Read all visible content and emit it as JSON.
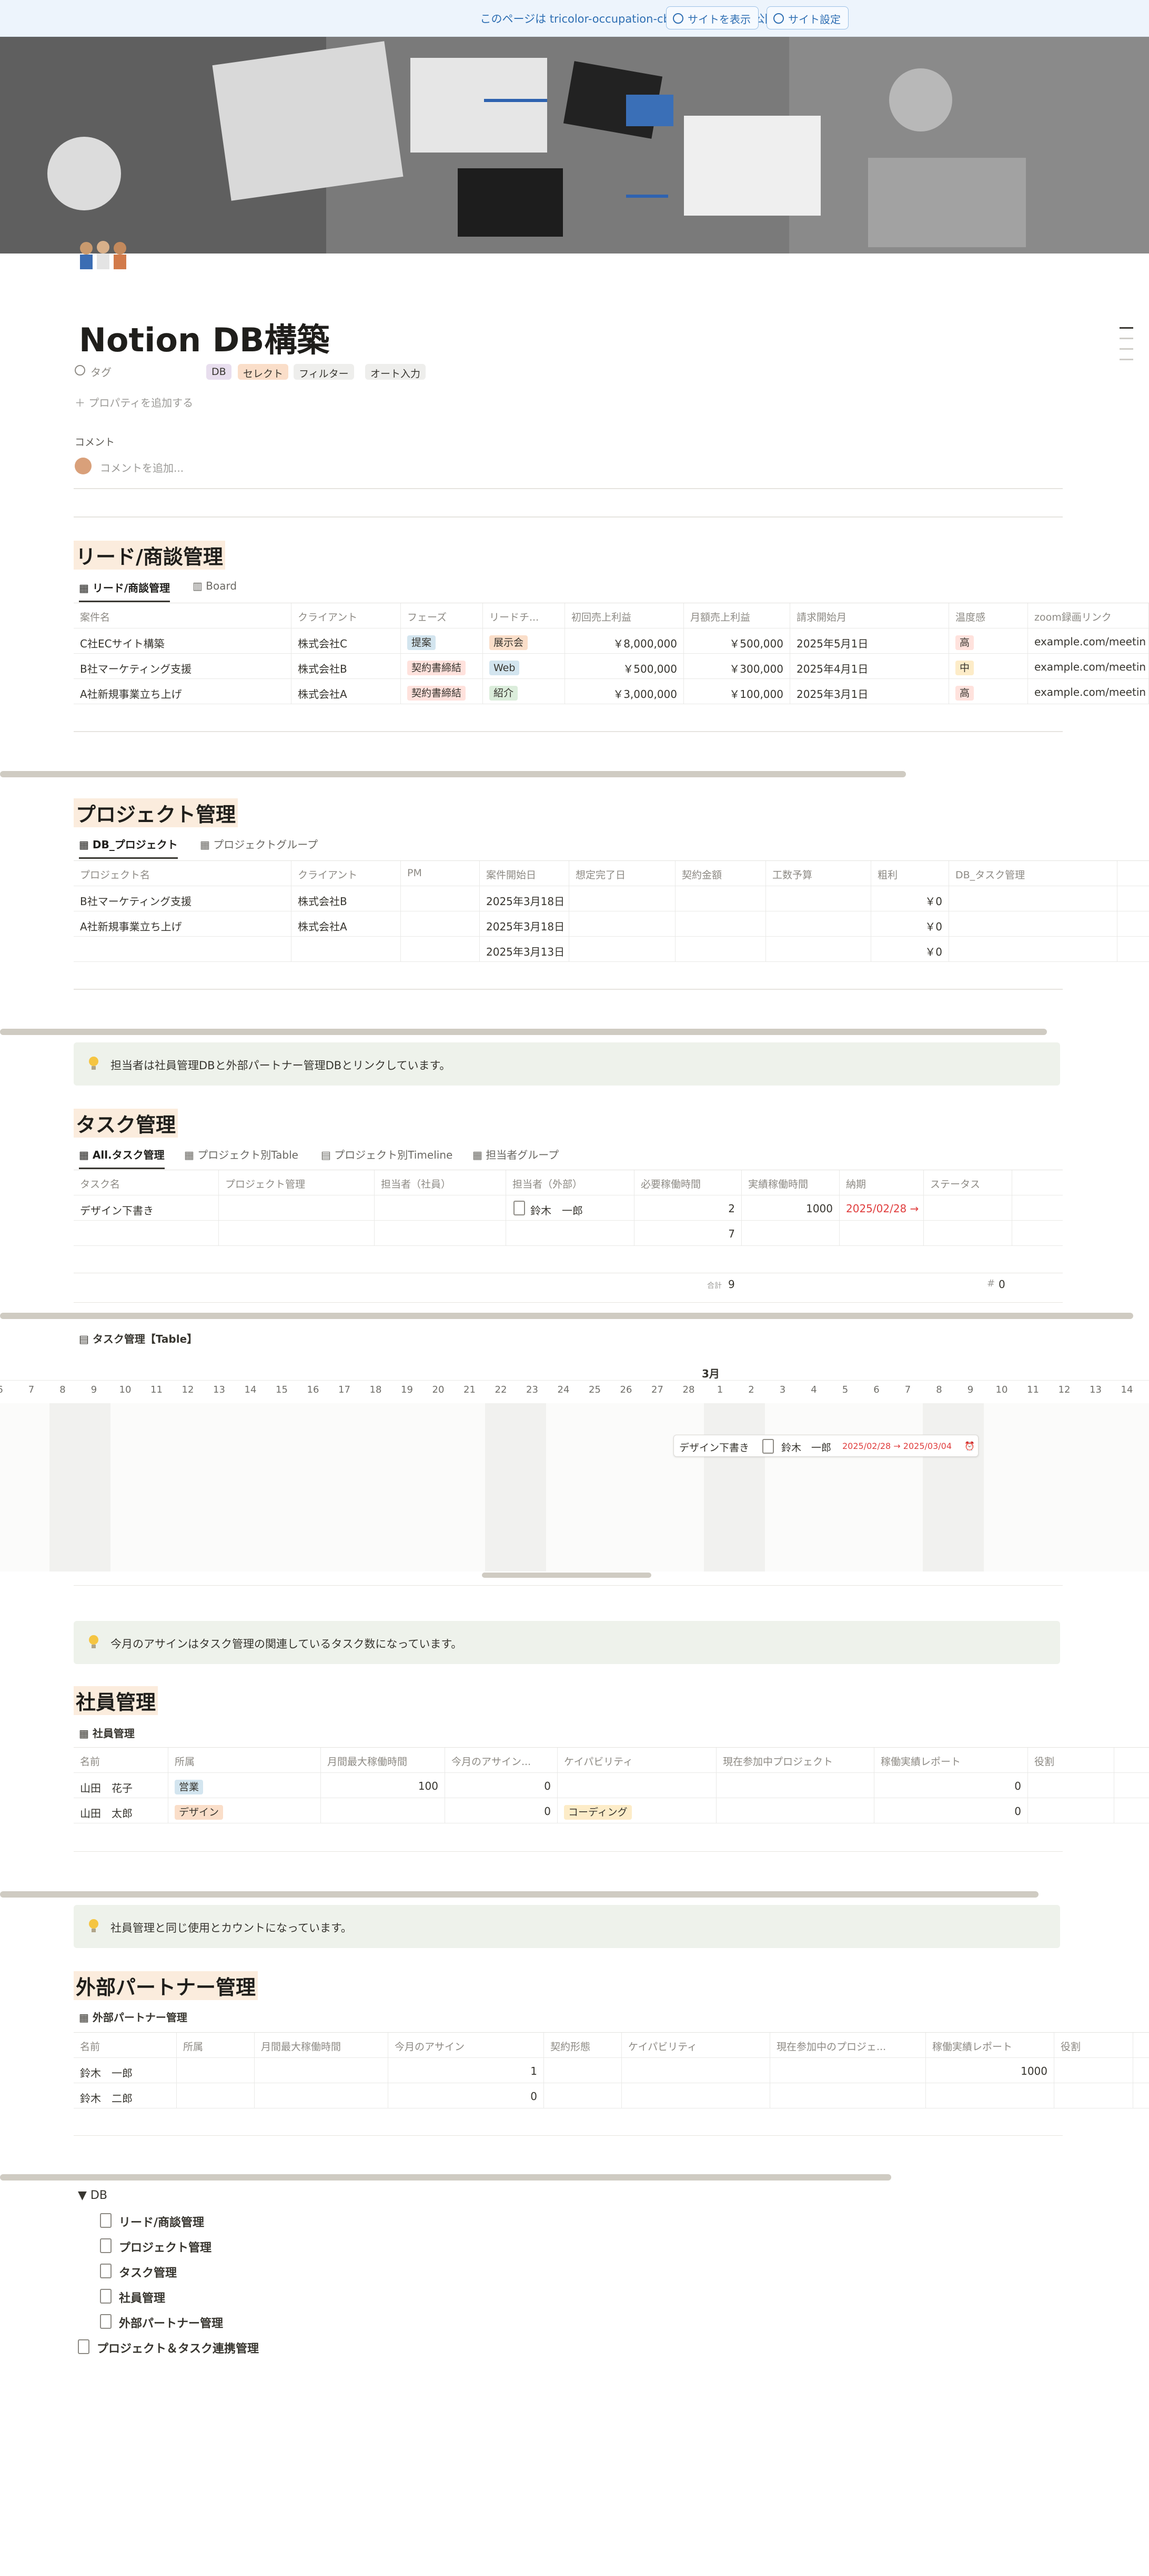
{
  "topbar": {
    "message": "このページは tricolor-occupation-cb8.notion.site で公開されています",
    "view_site": "サイトを表示",
    "site_settings": "サイト設定"
  },
  "page": {
    "title": "Notion DB構築",
    "tag_label": "タグ",
    "tags": [
      {
        "label": "DB",
        "color": "#e8deee"
      },
      {
        "label": "セレクト",
        "color": "#fadec9"
      },
      {
        "label": "フィルター",
        "color": "#eeeeec"
      },
      {
        "label": "オート入力",
        "color": "#eeeeec"
      }
    ],
    "add_property": "プロパティを追加する",
    "comment_label": "コメント",
    "comment_placeholder": "コメントを追加..."
  },
  "lead": {
    "heading": "リード/商談管理",
    "tabs": [
      "リード/商談管理",
      "Board"
    ],
    "columns": [
      "案件名",
      "クライアント",
      "フェーズ",
      "リードチ...",
      "初回売上利益",
      "月額売上利益",
      "請求開始月",
      "温度感",
      "zoom録画リンク"
    ],
    "rows": [
      [
        "C社ECサイト構築",
        "株式会社C",
        "提案",
        "展示会",
        "￥8,000,000",
        "￥500,000",
        "2025年5月1日",
        "高",
        "example.com/meetin"
      ],
      [
        "B社マーケティング支援",
        "株式会社B",
        "契約書締結",
        "Web",
        "￥500,000",
        "￥300,000",
        "2025年4月1日",
        "中",
        "example.com/meetin"
      ],
      [
        "A社新規事業立ち上げ",
        "株式会社A",
        "契約書締結",
        "紹介",
        "￥3,000,000",
        "￥100,000",
        "2025年3月1日",
        "高",
        "example.com/meetin"
      ]
    ]
  },
  "project": {
    "heading": "プロジェクト管理",
    "tabs": [
      "DB_プロジェクト",
      "プロジェクトグループ"
    ],
    "columns": [
      "プロジェクト名",
      "クライアント",
      "PM",
      "案件開始日",
      "想定完了日",
      "契約金額",
      "工数予算",
      "粗利",
      "DB_タスク管理"
    ],
    "rows": [
      [
        "B社マーケティング支援",
        "株式会社B",
        "",
        "2025年3月18日",
        "",
        "",
        "",
        "￥0",
        ""
      ],
      [
        "A社新規事業立ち上げ",
        "株式会社A",
        "",
        "2025年3月18日",
        "",
        "",
        "",
        "￥0",
        ""
      ],
      [
        "",
        "",
        "",
        "2025年3月13日",
        "",
        "",
        "",
        "￥0",
        ""
      ]
    ]
  },
  "task": {
    "callout": "担当者は社員管理DBと外部パートナー管理DBとリンクしています。",
    "heading": "タスク管理",
    "tabs": [
      "All.タスク管理",
      "プロジェクト別Table",
      "プロジェクト別Timeline",
      "担当者グループ"
    ],
    "columns": [
      "タスク名",
      "プロジェクト管理",
      "担当者（社員）",
      "担当者（外部）",
      "必要稼働時間",
      "実績稼働時間",
      "納期",
      "ステータス"
    ],
    "rows": [
      [
        "デザイン下書き",
        "",
        "",
        "鈴木　一郎",
        "2",
        "1000",
        "2025/02/28 →",
        ""
      ],
      [
        "",
        "",
        "",
        "",
        "7",
        "",
        "",
        ""
      ]
    ],
    "sum_label": "合計",
    "sum_required": "9",
    "sum_actual": "0"
  },
  "timeline": {
    "title": "タスク管理【Table】",
    "month": "3月",
    "days": [
      "6",
      "7",
      "8",
      "9",
      "10",
      "11",
      "12",
      "13",
      "14",
      "15",
      "16",
      "17",
      "18",
      "19",
      "20",
      "21",
      "22",
      "23",
      "24",
      "25",
      "26",
      "27",
      "28",
      "1",
      "2",
      "3",
      "4",
      "5",
      "6",
      "7",
      "8",
      "9",
      "10",
      "11",
      "12",
      "13",
      "14"
    ],
    "bar_task": "デザイン下書き",
    "bar_person": "鈴木　一郎",
    "bar_dates": "2025/02/28 → 2025/03/04"
  },
  "employee": {
    "callout": "今月のアサインはタスク管理の関連しているタスク数になっています。",
    "heading": "社員管理",
    "tab": "社員管理",
    "columns": [
      "名前",
      "所属",
      "月間最大稼働時間",
      "今月のアサイン...",
      "ケイパビリティ",
      "現在参加中プロジェクト",
      "稼働実績レポート",
      "役割"
    ],
    "rows": [
      [
        "山田　花子",
        "営業",
        "100",
        "0",
        "",
        "",
        "0",
        ""
      ],
      [
        "山田　太郎",
        "デザイン",
        "",
        "0",
        "コーディング",
        "",
        "0",
        ""
      ]
    ]
  },
  "partner": {
    "callout": "社員管理と同じ使用とカウントになっています。",
    "heading": "外部パートナー管理",
    "tab": "外部パートナー管理",
    "columns": [
      "名前",
      "所属",
      "月間最大稼働時間",
      "今月のアサイン",
      "契約形態",
      "ケイパビリティ",
      "現在参加中のプロジェ...",
      "稼働実績レポート",
      "役割"
    ],
    "rows": [
      [
        "鈴木　一郎",
        "",
        "",
        "1",
        "",
        "",
        "",
        "1000",
        ""
      ],
      [
        "鈴木　二郎",
        "",
        "",
        "0",
        "",
        "",
        "",
        "",
        ""
      ]
    ]
  },
  "db_toggle": {
    "label": "DB",
    "items": [
      "リード/商談管理",
      "プロジェクト管理",
      "タスク管理",
      "社員管理",
      "外部パートナー管理"
    ]
  },
  "footer_link": "プロジェクト＆タスク連携管理"
}
